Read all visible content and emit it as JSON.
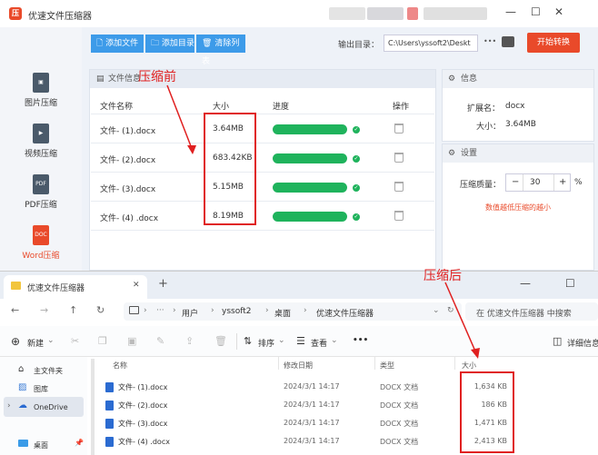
{
  "app": {
    "logo_text": "压",
    "title": "优速文件压缩器",
    "window_controls": [
      "—",
      "☐",
      "✕"
    ]
  },
  "sidebar": {
    "items": [
      {
        "label": "图片压缩",
        "icon": "image-icon"
      },
      {
        "label": "视频压缩",
        "icon": "video-icon"
      },
      {
        "label": "PDF压缩",
        "icon": "pdf-icon",
        "icon_text": "PDF"
      },
      {
        "label": "Word压缩",
        "icon": "word-icon",
        "icon_text": "DOC",
        "active": true
      }
    ]
  },
  "toolbar": {
    "add_file": "添加文件",
    "add_dir": "添加目录",
    "clear_list": "清除列表",
    "output_label": "输出目录：",
    "output_path": "C:\\Users\\yssoft2\\Deskt",
    "more": "•••",
    "start": "开始转换"
  },
  "file_panel": {
    "header": "文件信息",
    "columns": [
      "文件名称",
      "大小",
      "进度",
      "操作"
    ],
    "rows": [
      {
        "name": "文件- (1).docx",
        "size": "3.64MB",
        "progress": 1.0
      },
      {
        "name": "文件- (2).docx",
        "size": "683.42KB",
        "progress": 1.0
      },
      {
        "name": "文件- (3).docx",
        "size": "5.15MB",
        "progress": 1.0
      },
      {
        "name": "文件- (4) .docx",
        "size": "8.19MB",
        "progress": 1.0
      }
    ]
  },
  "info_panel": {
    "header": "信息",
    "ext_label": "扩展名：",
    "ext_value": "docx",
    "size_label": "大小：",
    "size_value": "3.64MB"
  },
  "settings_panel": {
    "header": "设置",
    "quality_label": "压缩质量：",
    "minus": "−",
    "quality_value": "30",
    "plus": "+",
    "unit": "%",
    "hint": "数值越低压缩的越小"
  },
  "annotations": {
    "before": "压缩前",
    "after": "压缩后",
    "color": "#e02020"
  },
  "explorer": {
    "tab_title": "优速文件压缩器",
    "tab_close": "✕",
    "new_tab": "+",
    "path": [
      "用户",
      "yssoft2",
      "桌面",
      "优速文件压缩器"
    ],
    "search_placeholder": "在 优速文件压缩器 中搜索",
    "new_label": "新建",
    "sort_label": "排序",
    "view_label": "查看",
    "more": "•••",
    "details_label": "详细信息",
    "sidebar": [
      {
        "label": "主文件夹",
        "icon": "home-icon"
      },
      {
        "label": "图库",
        "icon": "gallery-icon"
      },
      {
        "label": "OneDrive",
        "icon": "cloud-icon"
      },
      {
        "label": "桌面",
        "icon": "desktop-icon"
      }
    ],
    "columns": [
      "名称",
      "修改日期",
      "类型",
      "大小"
    ],
    "rows": [
      {
        "name": "文件- (1).docx",
        "date": "2024/3/1 14:17",
        "type": "DOCX 文档",
        "size": "1,634 KB"
      },
      {
        "name": "文件- (2).docx",
        "date": "2024/3/1 14:17",
        "type": "DOCX 文档",
        "size": "186 KB"
      },
      {
        "name": "文件- (3).docx",
        "date": "2024/3/1 14:17",
        "type": "DOCX 文档",
        "size": "1,471 KB"
      },
      {
        "name": "文件- (4) .docx",
        "date": "2024/3/1 14:17",
        "type": "DOCX 文档",
        "size": "2,413 KB"
      }
    ]
  }
}
